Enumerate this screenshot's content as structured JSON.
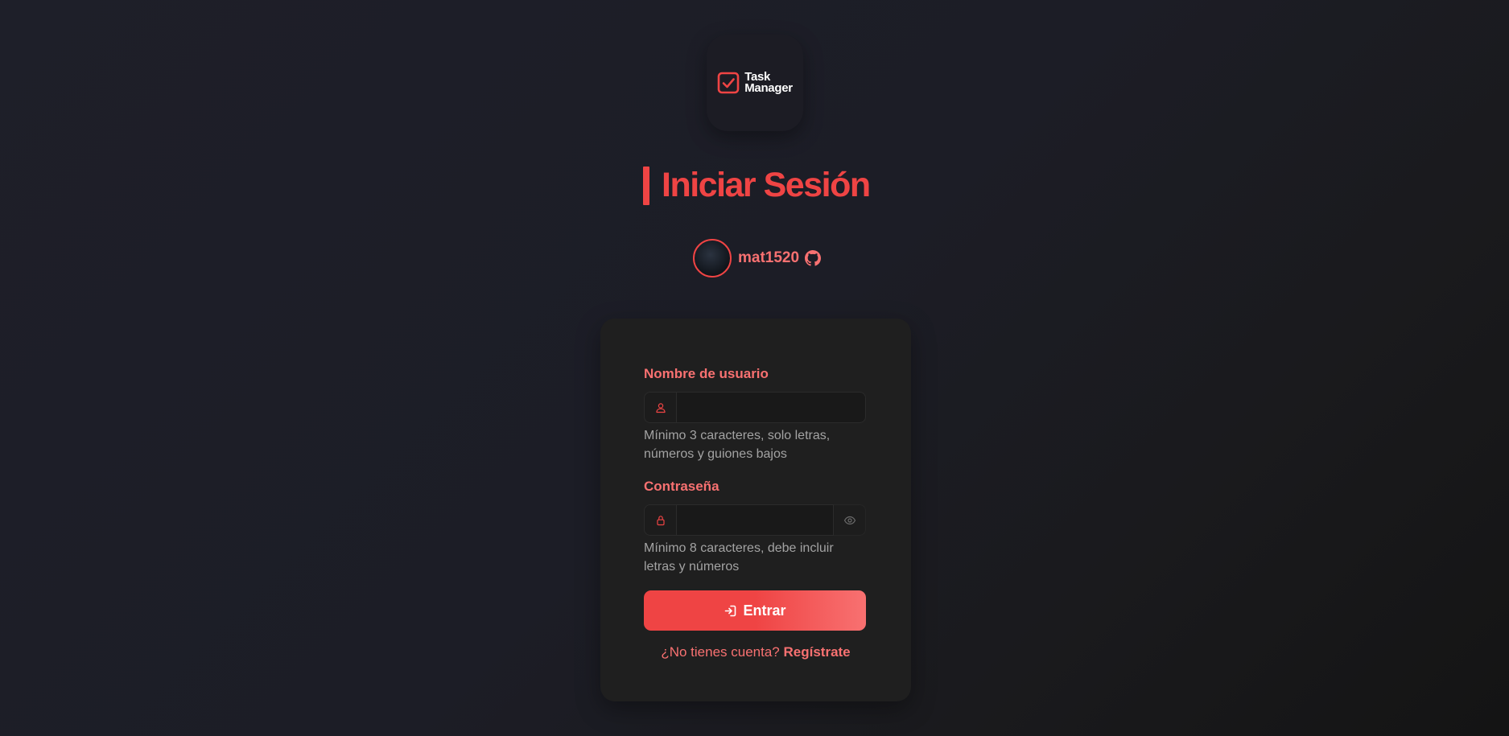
{
  "logo": {
    "line1": "Task",
    "line2": "Manager",
    "icon": "check-square-icon"
  },
  "page": {
    "title": "Iniciar Sesión"
  },
  "author": {
    "username": "mat1520",
    "icon": "github-icon"
  },
  "form": {
    "username": {
      "label": "Nombre de usuario",
      "value": "",
      "icon": "user-icon",
      "hint": "Mínimo 3 caracteres, solo letras, números y guiones bajos"
    },
    "password": {
      "label": "Contraseña",
      "value": "",
      "icon": "lock-icon",
      "toggle_icon": "eye-icon",
      "hint": "Mínimo 8 caracteres, debe incluir letras y números"
    },
    "submit_label": "Entrar",
    "submit_icon": "login-icon",
    "register_prompt": "¿No tienes cuenta?",
    "register_link": "Regístrate"
  },
  "colors": {
    "accent": "#ef4444",
    "accent_light": "#f87171",
    "background": "#1e1f29",
    "card": "#1f1f1f"
  }
}
